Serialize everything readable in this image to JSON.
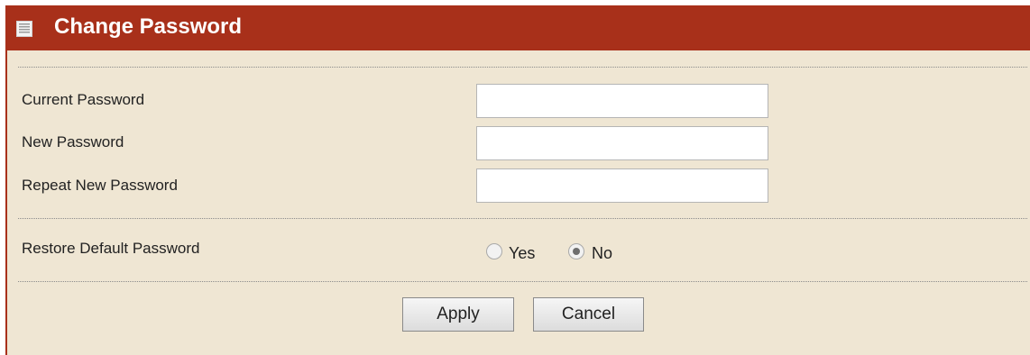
{
  "header": {
    "title": "Change Password",
    "icon": "document-icon",
    "background": "#a8301a"
  },
  "form": {
    "current_password": {
      "label": "Current Password",
      "value": ""
    },
    "new_password": {
      "label": "New Password",
      "value": ""
    },
    "repeat_password": {
      "label": "Repeat New Password",
      "value": ""
    },
    "restore_default": {
      "label": "Restore Default Password",
      "options": [
        {
          "label": "Yes",
          "checked": false
        },
        {
          "label": "No",
          "checked": true
        }
      ]
    }
  },
  "buttons": {
    "apply": "Apply",
    "cancel": "Cancel"
  },
  "colors": {
    "panel_background": "#efe6d3",
    "accent": "#a8301a"
  }
}
